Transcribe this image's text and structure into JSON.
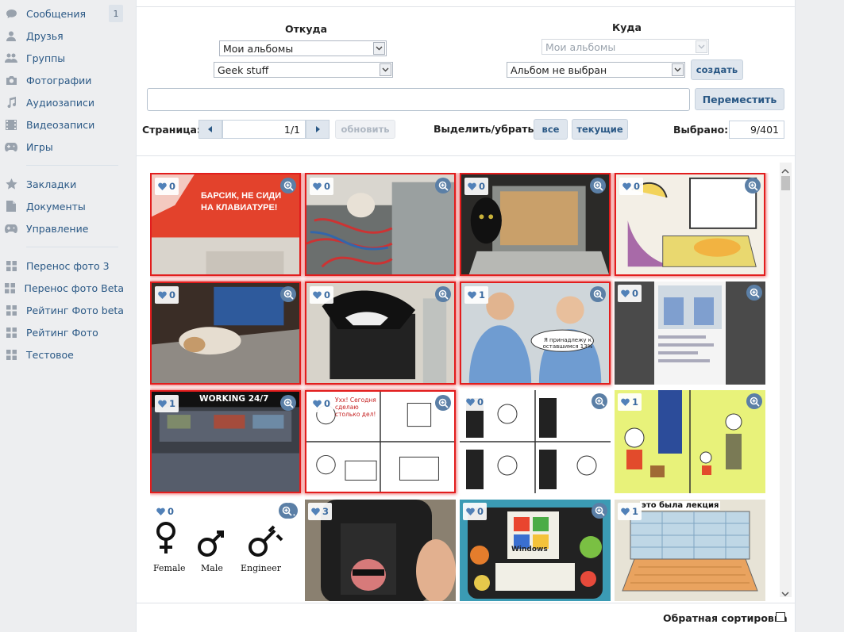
{
  "sidebar": {
    "items": [
      {
        "label": "Сообщения",
        "icon": "messages-icon",
        "badge": "1"
      },
      {
        "label": "Друзья",
        "icon": "friends-icon"
      },
      {
        "label": "Группы",
        "icon": "groups-icon"
      },
      {
        "label": "Фотографии",
        "icon": "camera-icon"
      },
      {
        "label": "Аудиозаписи",
        "icon": "music-icon"
      },
      {
        "label": "Видеозаписи",
        "icon": "film-icon"
      },
      {
        "label": "Игры",
        "icon": "gamepad-icon"
      },
      {
        "label": "Закладки",
        "icon": "star-icon"
      },
      {
        "label": "Документы",
        "icon": "document-icon"
      },
      {
        "label": "Управление",
        "icon": "gamepad-icon"
      },
      {
        "label": "Перенос фото 3",
        "icon": "app-icon"
      },
      {
        "label": "Перенос фото Beta",
        "icon": "app-icon"
      },
      {
        "label": "Рейтинг Фото beta",
        "icon": "app-icon"
      },
      {
        "label": "Рейтинг Фото",
        "icon": "app-icon"
      },
      {
        "label": "Тестовое",
        "icon": "app-icon"
      }
    ]
  },
  "source": {
    "title": "Откуда",
    "albums_value": "Мои альбомы",
    "album_value": "Geek stuff"
  },
  "target": {
    "title": "Куда",
    "albums_value": "Мои альбомы",
    "album_value": "Альбом не выбран",
    "create_label": "создать"
  },
  "move_label": "Переместить",
  "pager": {
    "label": "Страница:",
    "value": "1/1",
    "refresh_label": "обновить"
  },
  "select": {
    "label": "Выделить/убрать:",
    "all_label": "все",
    "current_label": "текущие"
  },
  "selected": {
    "label": "Выбрано:",
    "value": "9/401"
  },
  "photos": [
    {
      "likes": "0",
      "selected": true,
      "caption": "БАРСИК, НЕ СИДИ НА КЛАВИАТУРЕ!"
    },
    {
      "likes": "0",
      "selected": true
    },
    {
      "likes": "0",
      "selected": true
    },
    {
      "likes": "0",
      "selected": true
    },
    {
      "likes": "0",
      "selected": true
    },
    {
      "likes": "0",
      "selected": true
    },
    {
      "likes": "1",
      "selected": true,
      "caption": "Я принадлежу к оставшимся 13%"
    },
    {
      "likes": "0",
      "selected": false
    },
    {
      "likes": "1",
      "selected": true,
      "caption": "WORKING 24/7"
    },
    {
      "likes": "0",
      "selected": true,
      "caption": "Ухх! Сегодня сделаю столько дел!"
    },
    {
      "likes": "0",
      "selected": false
    },
    {
      "likes": "1",
      "selected": false
    },
    {
      "likes": "0",
      "selected": false,
      "captions": [
        "Female",
        "Male",
        "Engineer"
      ]
    },
    {
      "likes": "3",
      "selected": false
    },
    {
      "likes": "0",
      "selected": false,
      "caption": "Windows"
    },
    {
      "likes": "1",
      "selected": false,
      "caption": "это была лекция"
    }
  ],
  "reverse_sort_label": "Обратная сортировка",
  "colors": {
    "link": "#2a5885",
    "selection": "#e21d1d",
    "button_bg": "#dfe6ee",
    "zoom_bg": "#5b7fa6"
  }
}
